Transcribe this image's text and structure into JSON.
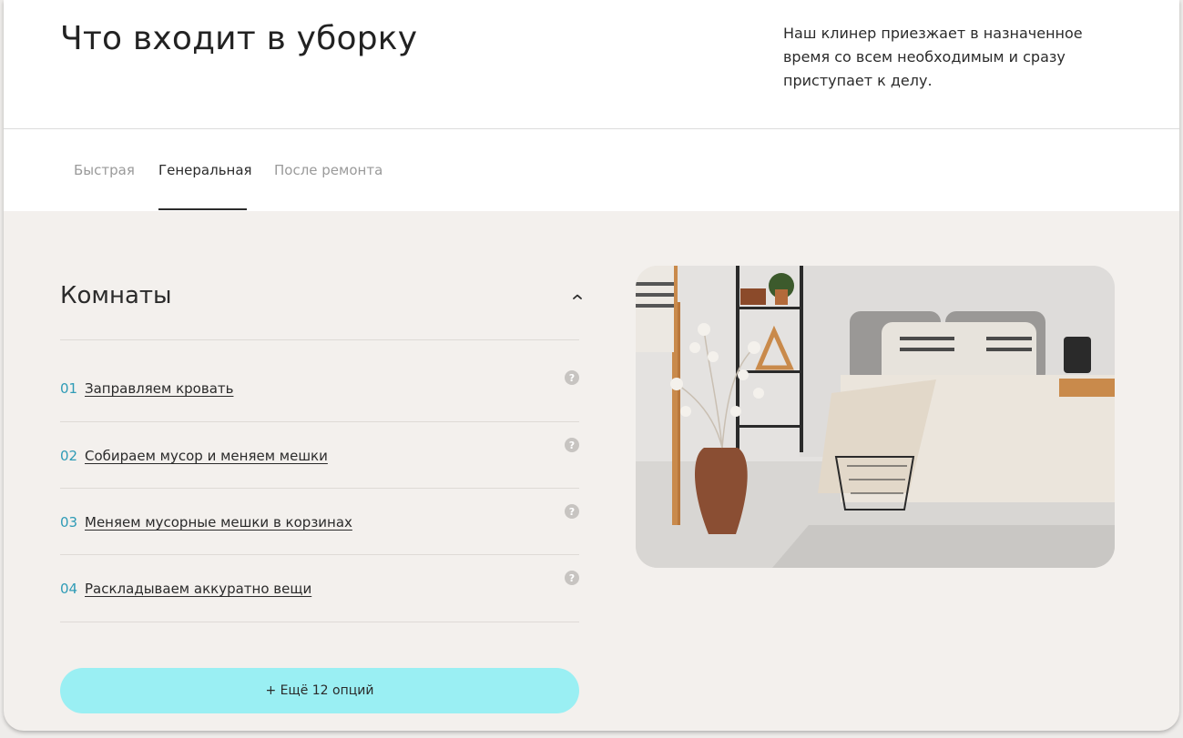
{
  "header": {
    "title": "Что входит в уборку",
    "description": "Наш клинер приезжает в назначенное время со всем необходимым и сразу приступает к делу."
  },
  "tabs": [
    {
      "label": "Быстрая",
      "active": false
    },
    {
      "label": "Генеральная",
      "active": true
    },
    {
      "label": "После ремонта",
      "active": false
    }
  ],
  "section": {
    "title": "Комнаты",
    "expanded": true,
    "items": [
      {
        "num": "01",
        "label": "Заправляем кровать"
      },
      {
        "num": "02",
        "label": "Собираем мусор и меняем мешки"
      },
      {
        "num": "03",
        "label": "Меняем мусорные мешки в корзинах"
      },
      {
        "num": "04",
        "label": "Раскладываем аккуратно вещи"
      }
    ],
    "help_icon": "question-circle-icon",
    "more_button": "+ Ещё 12 опций"
  },
  "colors": {
    "accent": "#2e9bb6",
    "button_bg": "#9aeff3",
    "panel_bg": "#f3f0ed"
  }
}
